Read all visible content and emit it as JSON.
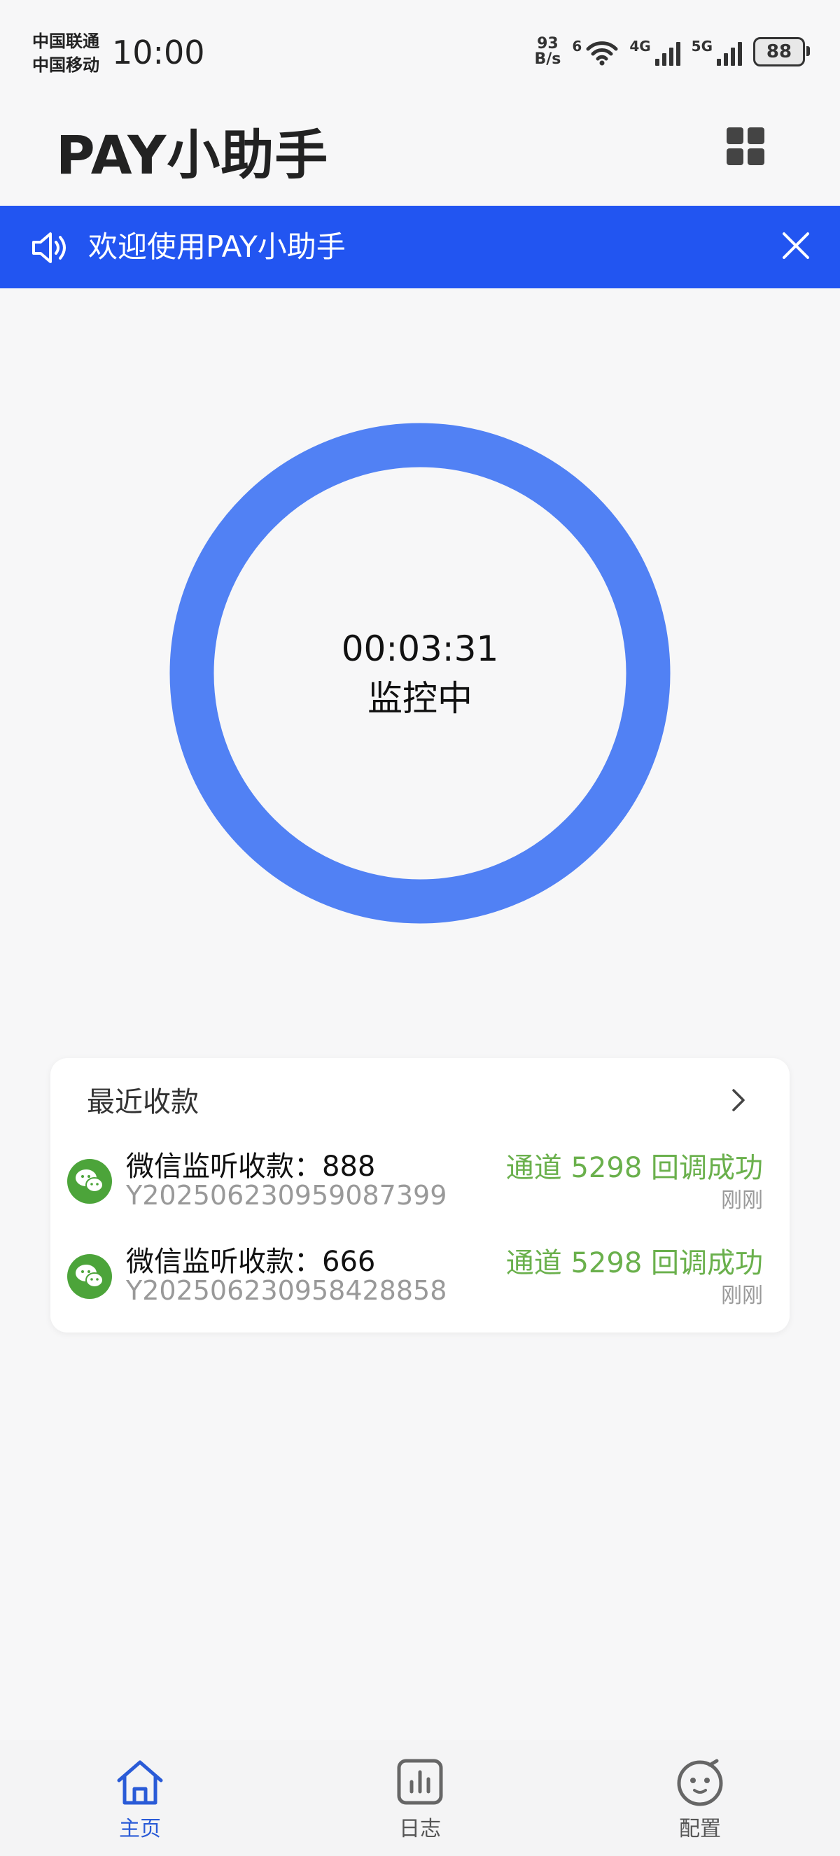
{
  "status_bar": {
    "carrier_1": "中国联通",
    "carrier_2": "中国移动",
    "time": "10:00",
    "net_speed_value": "93",
    "net_speed_unit": "B/s",
    "wifi_label": "6",
    "sig1_label": "4G",
    "sig2_label": "5G",
    "battery": "88"
  },
  "header": {
    "title": "PAY小助手",
    "menu_icon": "grid-icon"
  },
  "banner": {
    "text": "欢迎使用PAY小助手",
    "bg_color": "#2255f1"
  },
  "monitor": {
    "timer": "00:03:31",
    "status": "监控中",
    "ring_color": "#5181f4"
  },
  "recent": {
    "title": "最近收款",
    "items": [
      {
        "title": "微信监听收款：888",
        "order_id": "Y202506230959087399",
        "result": "通道 5298 回调成功",
        "time": "刚刚"
      },
      {
        "title": "微信监听收款：666",
        "order_id": "Y202506230958428858",
        "result": "通道 5298 回调成功",
        "time": "刚刚"
      }
    ],
    "success_color": "#6ab04c"
  },
  "nav": {
    "items": [
      {
        "label": "主页",
        "icon": "home-icon",
        "active": true
      },
      {
        "label": "日志",
        "icon": "chart-icon",
        "active": false
      },
      {
        "label": "配置",
        "icon": "smile-icon",
        "active": false
      }
    ],
    "active_color": "#2a5bd7"
  }
}
